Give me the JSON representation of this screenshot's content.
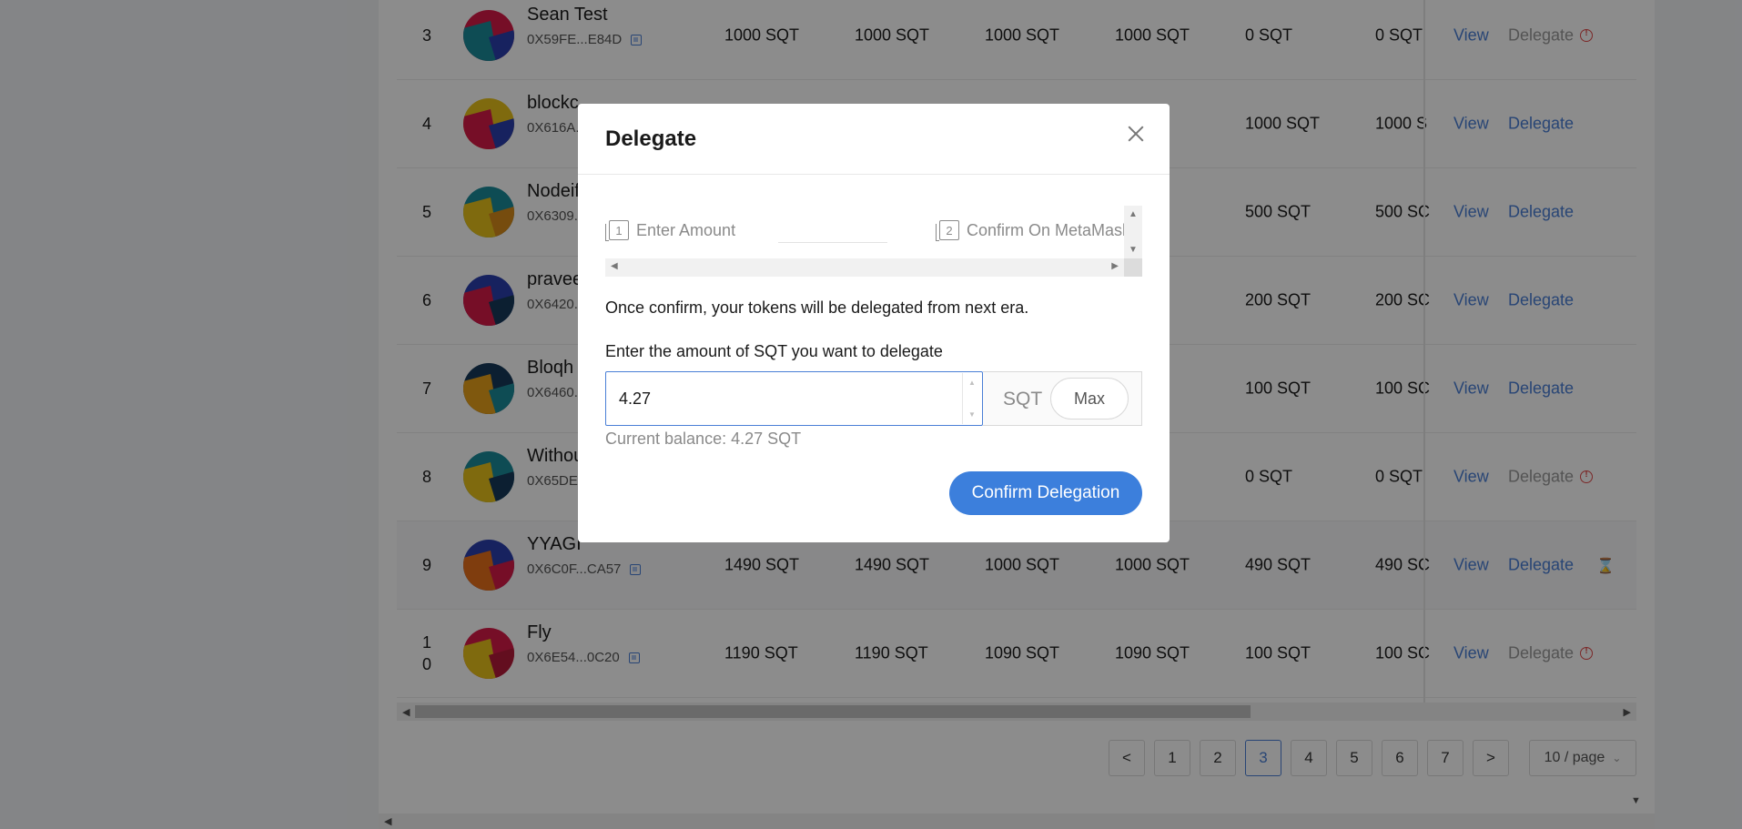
{
  "table": {
    "rows": [
      {
        "index": "3",
        "name": "Sean Test",
        "address": "0X59FE...E84D",
        "c1": "1000 SQT",
        "c2": "1000 SQT",
        "c3": "1000 SQT",
        "c4": "1000 SQT",
        "c5": "0 SQT",
        "c6": "0 SQT",
        "view": "View",
        "delegate": "Delegate",
        "delegate_disabled": true,
        "status": "warn"
      },
      {
        "index": "4",
        "name": "blockc",
        "address": "0X616A...",
        "c1": "",
        "c2": "",
        "c3": "",
        "c4": "QT",
        "c5": "1000 SQT",
        "c6": "1000 S",
        "view": "View",
        "delegate": "Delegate",
        "delegate_disabled": false,
        "status": ""
      },
      {
        "index": "5",
        "name": "Nodeif",
        "address": "0X6309...",
        "c1": "",
        "c2": "",
        "c3": "",
        "c4": "QT",
        "c5": "500 SQT",
        "c6": "500 SC",
        "view": "View",
        "delegate": "Delegate",
        "delegate_disabled": false,
        "status": ""
      },
      {
        "index": "6",
        "name": "pravee",
        "address": "0X6420...",
        "c1": "",
        "c2": "",
        "c3": "",
        "c4": "QT",
        "c5": "200 SQT",
        "c6": "200 SC",
        "view": "View",
        "delegate": "Delegate",
        "delegate_disabled": false,
        "status": ""
      },
      {
        "index": "7",
        "name": "Bloqh",
        "address": "0X6460...",
        "c1": "",
        "c2": "",
        "c3": "",
        "c4": "QT",
        "c5": "100 SQT",
        "c6": "100 SC",
        "view": "View",
        "delegate": "Delegate",
        "delegate_disabled": false,
        "status": ""
      },
      {
        "index": "8",
        "name": "Withou",
        "address": "0X65DE...",
        "c1": "",
        "c2": "",
        "c3": "",
        "c4": "QT",
        "c5": "0 SQT",
        "c6": "0 SQT",
        "view": "View",
        "delegate": "Delegate",
        "delegate_disabled": true,
        "status": "warn"
      },
      {
        "index": "9",
        "name": "YYAGI",
        "address": "0X6C0F...CA57",
        "c1": "1490 SQT",
        "c2": "1490 SQT",
        "c3": "1000 SQT",
        "c4": "1000 SQT",
        "c5": "490 SQT",
        "c6": "490 SC",
        "view": "View",
        "delegate": "Delegate",
        "delegate_disabled": false,
        "status": "pending"
      },
      {
        "index": "1\n0",
        "name": "Fly",
        "address": "0X6E54...0C20",
        "c1": "1190 SQT",
        "c2": "1190 SQT",
        "c3": "1090 SQT",
        "c4": "1090 SQT",
        "c5": "100 SQT",
        "c6": "100 SC",
        "view": "View",
        "delegate": "Delegate",
        "delegate_disabled": true,
        "status": "warn"
      }
    ]
  },
  "pagination": {
    "prev": "<",
    "pages": [
      "1",
      "2",
      "3",
      "4",
      "5",
      "6",
      "7"
    ],
    "active": "3",
    "next": ">",
    "page_size": "10 / page"
  },
  "modal": {
    "title": "Delegate",
    "steps": [
      {
        "number": "1",
        "label": "Enter Amount"
      },
      {
        "number": "2",
        "label": "Confirm On MetaMask"
      }
    ],
    "notice": "Once confirm, your tokens will be delegated from next era.",
    "amount_label": "Enter the amount of SQT you want to delegate",
    "amount_value": "4.27",
    "unit": "SQT",
    "max_label": "Max",
    "balance": "Current balance: 4.27 SQT",
    "confirm_label": "Confirm Delegation"
  },
  "colors": {
    "accent": "#3c7fdc",
    "link": "#4a7fd6",
    "warning": "#e04a4a",
    "overlay": "rgba(0,0,0,0.45)"
  }
}
